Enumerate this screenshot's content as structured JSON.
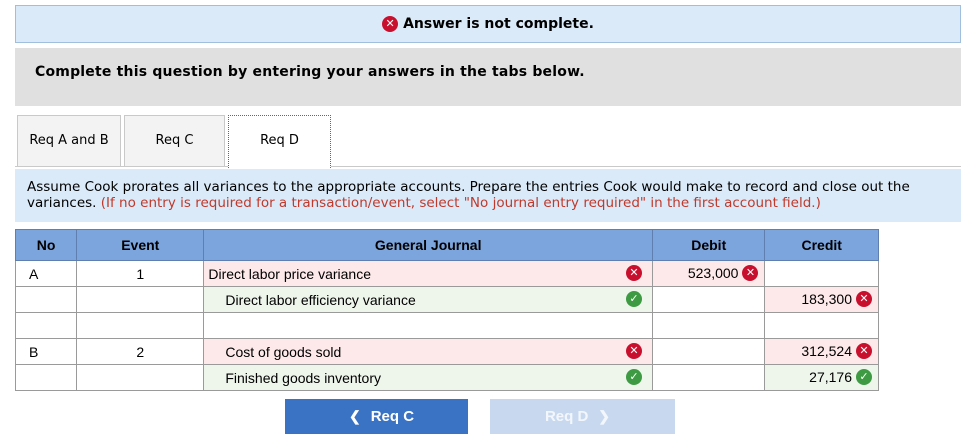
{
  "banner": {
    "status_text": "Answer is not complete."
  },
  "instructions": "Complete this question by entering your answers in the tabs below.",
  "tabs": [
    {
      "label": "Req A and B",
      "active": false
    },
    {
      "label": "Req C",
      "active": false
    },
    {
      "label": "Req D",
      "active": true
    }
  ],
  "question": {
    "text": "Assume Cook prorates all variances to the appropriate accounts. Prepare the entries Cook would make to record and close out the variances.",
    "note": "(If no entry is required for a transaction/event, select \"No journal entry required\" in the first account field.)"
  },
  "journal": {
    "headers": {
      "no": "No",
      "event": "Event",
      "general_journal": "General Journal",
      "debit": "Debit",
      "credit": "Credit"
    },
    "rows": [
      {
        "no": "A",
        "event": "1",
        "account": "Direct labor price variance",
        "account_status": "incorrect",
        "debit": "523,000",
        "debit_status": "incorrect",
        "credit": "",
        "credit_status": ""
      },
      {
        "no": "",
        "event": "",
        "account": "Direct labor efficiency variance",
        "account_status": "correct",
        "debit": "",
        "debit_status": "",
        "credit": "183,300",
        "credit_status": "incorrect"
      },
      {
        "no": "",
        "event": "",
        "account": "",
        "account_status": "",
        "debit": "",
        "debit_status": "",
        "credit": "",
        "credit_status": ""
      },
      {
        "no": "B",
        "event": "2",
        "account": "Cost of goods sold",
        "account_status": "incorrect",
        "debit": "",
        "debit_status": "",
        "credit": "312,524",
        "credit_status": "incorrect"
      },
      {
        "no": "",
        "event": "",
        "account": "Finished goods inventory",
        "account_status": "correct",
        "debit": "",
        "debit_status": "",
        "credit": "27,176",
        "credit_status": "correct"
      }
    ]
  },
  "nav": {
    "prev_label": "Req C",
    "next_label": "Req D",
    "next_enabled": false
  },
  "colors": {
    "error": "#c8102e",
    "correct": "#3e9b43",
    "header_blue": "#7ca4dd",
    "banner_blue": "#dbeaf8"
  }
}
